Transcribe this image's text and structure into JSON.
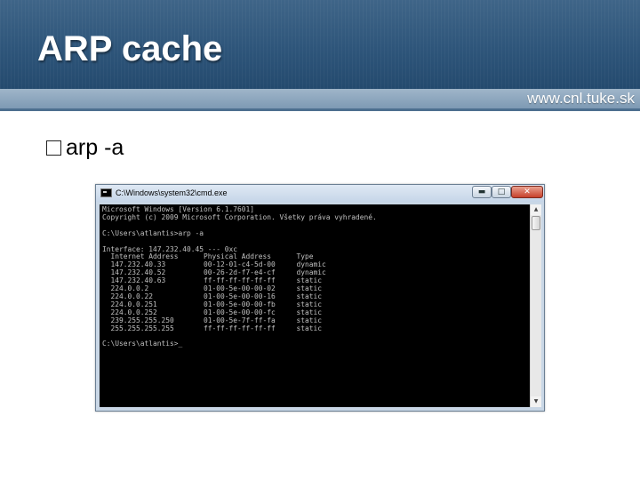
{
  "slide": {
    "title": "ARP cache",
    "site": "www.cnl.tuke.sk",
    "bullet_text": "arp -a",
    "header_color": "#2e557a"
  },
  "window": {
    "title": "C:\\Windows\\system32\\cmd.exe",
    "buttons": {
      "minimize": "▬",
      "maximize": "□",
      "close": "✕"
    },
    "scroll_up": "▲",
    "scroll_down": "▼"
  },
  "console": {
    "lines": [
      "Microsoft Windows [Version 6.1.7601]",
      "Copyright (c) 2009 Microsoft Corporation. Všetky práva vyhradené.",
      "",
      "C:\\Users\\atlantis>arp -a",
      "",
      "Interface: 147.232.40.45 --- 0xc",
      "  Internet Address      Physical Address      Type",
      "  147.232.40.33         00-12-01-c4-5d-00     dynamic",
      "  147.232.40.52         00-26-2d-f7-e4-cf     dynamic",
      "  147.232.40.63         ff-ff-ff-ff-ff-ff     static",
      "  224.0.0.2             01-00-5e-00-00-02     static",
      "  224.0.0.22            01-00-5e-00-00-16     static",
      "  224.0.0.251           01-00-5e-00-00-fb     static",
      "  224.0.0.252           01-00-5e-00-00-fc     static",
      "  239.255.255.250       01-00-5e-7f-ff-fa     static",
      "  255.255.255.255       ff-ff-ff-ff-ff-ff     static",
      "",
      "C:\\Users\\atlantis>_"
    ]
  }
}
